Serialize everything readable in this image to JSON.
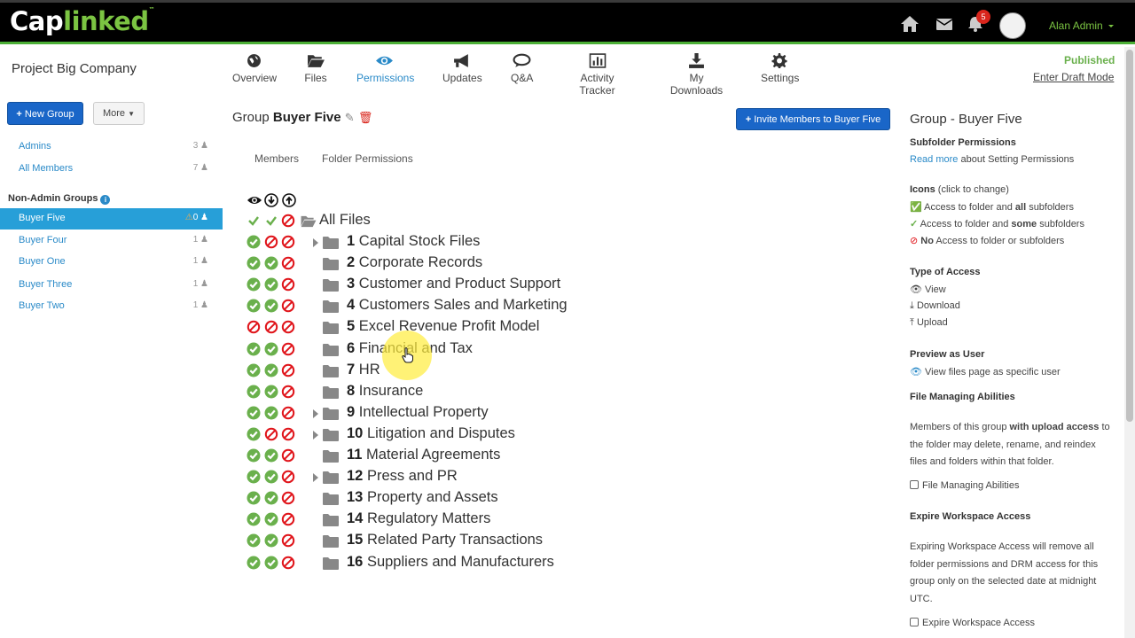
{
  "app": {
    "logo": "Caplinked",
    "user_name": "Alan Admin",
    "notification_count": "5"
  },
  "project": {
    "title": "Project Big Company",
    "status": "Published",
    "draft_link": "Enter Draft Mode"
  },
  "nav": [
    {
      "label": "Overview",
      "icon": "globe-icon"
    },
    {
      "label": "Files",
      "icon": "folder-open-icon"
    },
    {
      "label": "Permissions",
      "icon": "eye-icon",
      "active": true
    },
    {
      "label": "Updates",
      "icon": "megaphone-icon"
    },
    {
      "label": "Q&A",
      "icon": "chat-icon"
    },
    {
      "label": "Activity Tracker",
      "icon": "bar-chart-icon"
    },
    {
      "label": "My Downloads",
      "icon": "download-icon"
    },
    {
      "label": "Settings",
      "icon": "gear-icon"
    }
  ],
  "sidebar": {
    "new_group_label": "New Group",
    "more_label": "More",
    "admin_groups": [
      {
        "label": "Admins",
        "count": "3"
      },
      {
        "label": "All Members",
        "count": "7"
      }
    ],
    "non_admin_heading": "Non-Admin Groups",
    "groups": [
      {
        "label": "Buyer Five",
        "count": "0",
        "active": true,
        "warning": true
      },
      {
        "label": "Buyer Four",
        "count": "1"
      },
      {
        "label": "Buyer One",
        "count": "1"
      },
      {
        "label": "Buyer Three",
        "count": "1"
      },
      {
        "label": "Buyer Two",
        "count": "1"
      }
    ]
  },
  "main": {
    "group_prefix": "Group",
    "group_name": "Buyer Five",
    "invite_label": "Invite Members to Buyer Five",
    "tabs": [
      "Members",
      "Folder Permissions"
    ],
    "root_label": "All Files",
    "folders": [
      {
        "num": "1",
        "name": "Capital Stock Files",
        "perms": [
          "all",
          "none",
          "none"
        ],
        "expandable": true
      },
      {
        "num": "2",
        "name": "Corporate Records",
        "perms": [
          "all",
          "all",
          "none"
        ],
        "expandable": false
      },
      {
        "num": "3",
        "name": "Customer and Product Support",
        "perms": [
          "all",
          "all",
          "none"
        ],
        "expandable": false
      },
      {
        "num": "4",
        "name": "Customers Sales and Marketing",
        "perms": [
          "all",
          "all",
          "none"
        ],
        "expandable": false
      },
      {
        "num": "5",
        "name": "Excel Revenue Profit Model",
        "perms": [
          "none",
          "none",
          "none"
        ],
        "expandable": false
      },
      {
        "num": "6",
        "name": "Financial and Tax",
        "perms": [
          "all",
          "all",
          "none"
        ],
        "expandable": false
      },
      {
        "num": "7",
        "name": "HR",
        "perms": [
          "all",
          "all",
          "none"
        ],
        "expandable": false
      },
      {
        "num": "8",
        "name": "Insurance",
        "perms": [
          "all",
          "all",
          "none"
        ],
        "expandable": false
      },
      {
        "num": "9",
        "name": "Intellectual Property",
        "perms": [
          "all",
          "all",
          "none"
        ],
        "expandable": true
      },
      {
        "num": "10",
        "name": "Litigation and Disputes",
        "perms": [
          "all",
          "none",
          "none"
        ],
        "expandable": true
      },
      {
        "num": "11",
        "name": "Material Agreements",
        "perms": [
          "all",
          "all",
          "none"
        ],
        "expandable": false
      },
      {
        "num": "12",
        "name": "Press and PR",
        "perms": [
          "all",
          "all",
          "none"
        ],
        "expandable": true
      },
      {
        "num": "13",
        "name": "Property and Assets",
        "perms": [
          "all",
          "all",
          "none"
        ],
        "expandable": false
      },
      {
        "num": "14",
        "name": "Regulatory Matters",
        "perms": [
          "all",
          "all",
          "none"
        ],
        "expandable": false
      },
      {
        "num": "15",
        "name": "Related Party Transactions",
        "perms": [
          "all",
          "all",
          "none"
        ],
        "expandable": false
      },
      {
        "num": "16",
        "name": "Suppliers and Manufacturers",
        "perms": [
          "all",
          "all",
          "none"
        ],
        "expandable": false
      }
    ]
  },
  "right_panel": {
    "title": "Group - Buyer Five",
    "subfolder_heading": "Subfolder Permissions",
    "read_more": "Read more",
    "read_more_suffix": "about Setting Permissions",
    "icons_heading": "Icons",
    "icons_hint": "(click to change)",
    "legend_all_pre": "Access to folder and",
    "legend_all_bold": "all",
    "legend_all_post": "subfolders",
    "legend_some_pre": "Access to folder and",
    "legend_some_bold": "some",
    "legend_some_post": "subfolders",
    "legend_none_bold": "No",
    "legend_none_post": "Access to folder or subfolders",
    "type_heading": "Type of Access",
    "type_view": "View",
    "type_download": "Download",
    "type_upload": "Upload",
    "preview_heading": "Preview as User",
    "preview_link": "View files page as specific user",
    "fma_heading": "File Managing Abilities",
    "fma_text_pre": "Members of this group",
    "fma_text_bold": "with upload access",
    "fma_text_post": "to the folder may delete, rename, and reindex files and folders within that folder.",
    "fma_checkbox": "File Managing Abilities",
    "expire_heading": "Expire Workspace Access",
    "expire_text": "Expiring Workspace Access will remove all folder permissions and DRM access for this group only on the selected date at midnight UTC.",
    "expire_checkbox": "Expire Workspace Access"
  },
  "colors": {
    "accent_blue": "#1a66c8",
    "link_blue": "#2a8ac8",
    "green": "#6ab04c",
    "red": "#e0151b",
    "active_row": "#279fd8"
  }
}
